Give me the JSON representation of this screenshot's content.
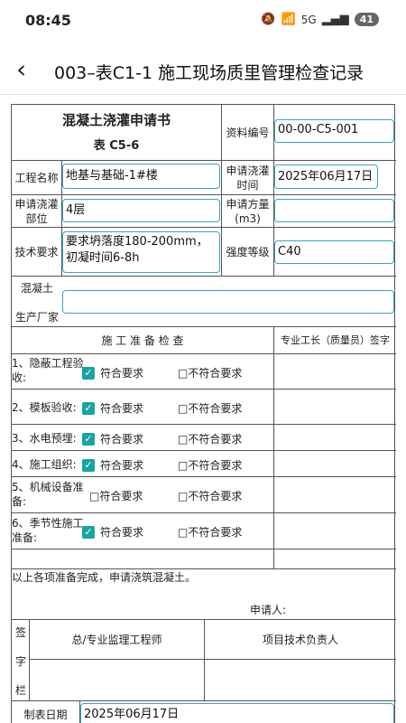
{
  "status": {
    "time": "08:45",
    "battery": "41",
    "network": "5G"
  },
  "header": {
    "title": "003–表C1-1 施工现场质里管理检查记录"
  },
  "form": {
    "title": "混凝土浇灌申请书",
    "subtitle": "表 C5-6",
    "doc_no_label": "资料编号",
    "doc_no_value": "00-00-C5-001",
    "project_label": "工程名称",
    "project_value": "地基与基础-1#楼",
    "pour_time_label": "申请浇灌时间",
    "pour_time_value": "2025年06月17日",
    "pour_part_label": "申请浇灌部位",
    "pour_part_value": "4层",
    "volume_label": "申请方量(m3)",
    "volume_value": "",
    "tech_label": "技术要求",
    "tech_value": "要求坍落度180-200mm，初凝时间6-8h",
    "grade_label": "强度等级",
    "grade_value": "C40",
    "maker_label_1": "混凝土",
    "maker_label_2": "生产厂家",
    "maker_value": "",
    "prep_header": "施 工 准 备 检 查",
    "foreman_header": "专业工长（质量员）签字",
    "checks": [
      {
        "label": "1、隐蔽工程验收:",
        "checked": true
      },
      {
        "label": "2、模板验收:",
        "checked": true
      },
      {
        "label": "3、水电预埋:",
        "checked": true
      },
      {
        "label": "4、施工组织:",
        "checked": true
      },
      {
        "label": "5、机械设备准备:",
        "checked": false
      },
      {
        "label": "6、季节性施工准备:",
        "checked": true
      }
    ],
    "ok_text": "符合要求",
    "ok_text_box": "□符合要求",
    "not_ok_text": "□不符合要求",
    "summary": "以上各项准备完成，申请浇筑混凝土。",
    "applicant_label": "申请人:",
    "sign_chars": [
      "签",
      "字",
      "栏"
    ],
    "supervisor_label": "总/专业监理工程师",
    "tech_lead_label": "项目技术负责人",
    "date_label": "制表日期",
    "date_value": "2025年06月17日"
  }
}
